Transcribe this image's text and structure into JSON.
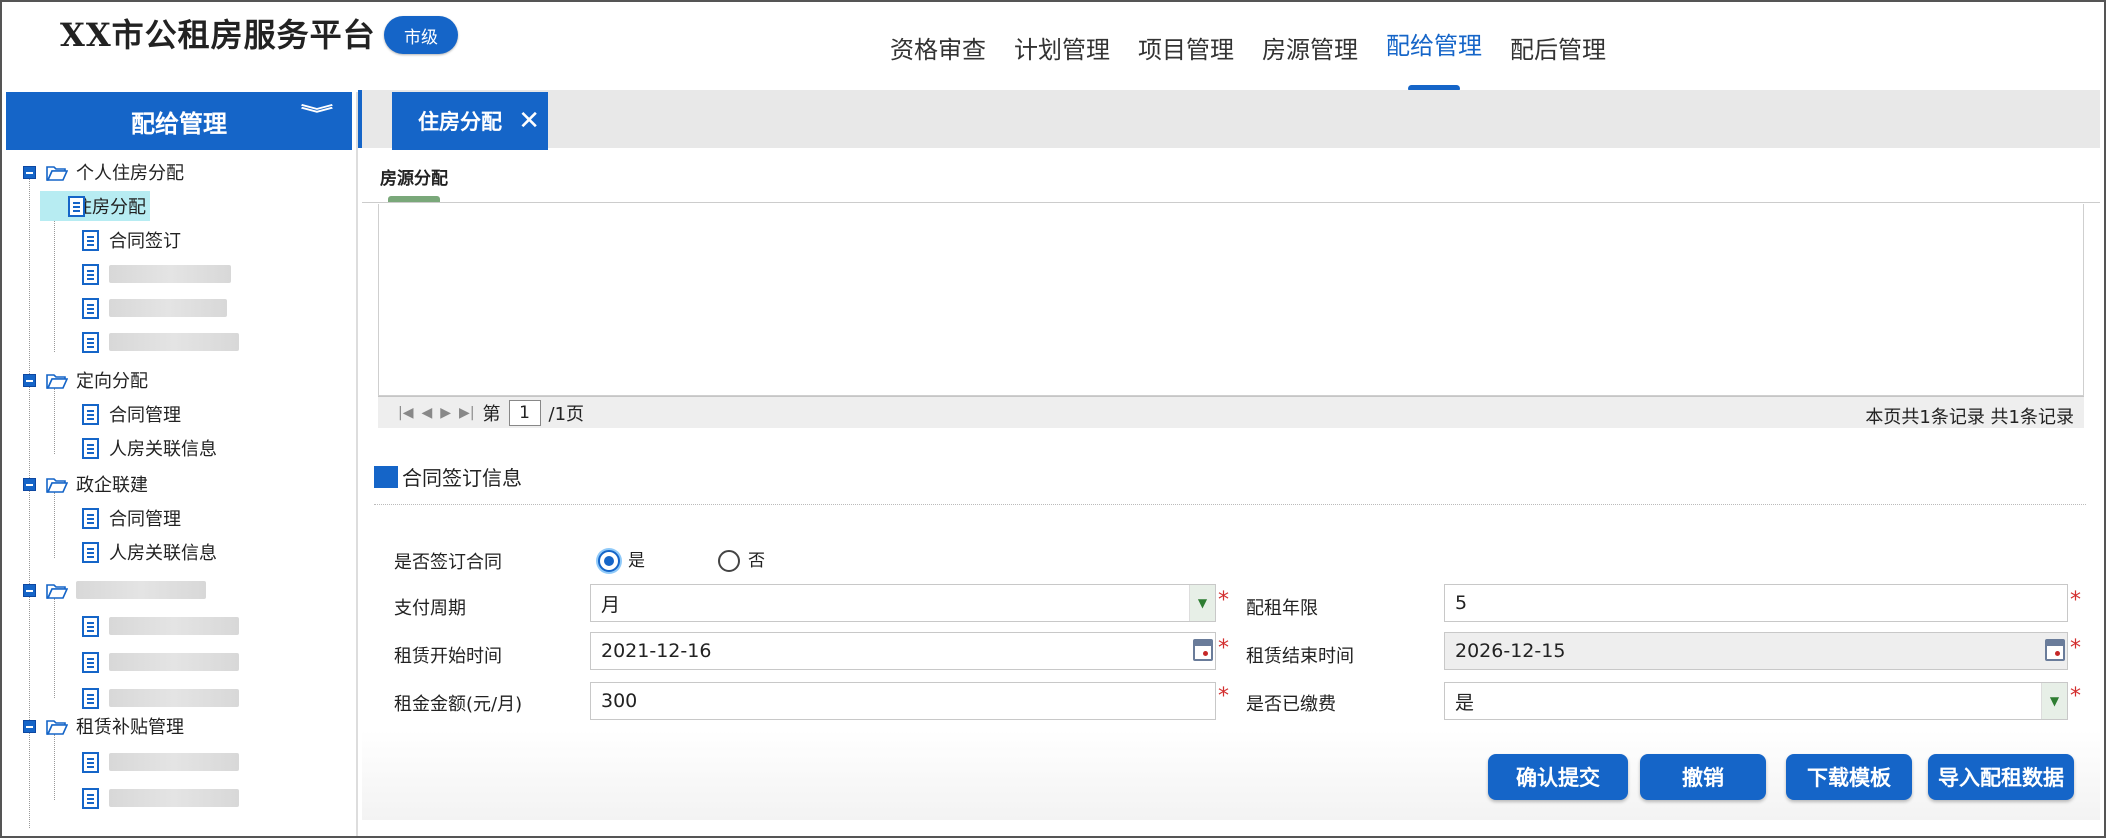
{
  "header": {
    "app_title": "XX市公租房服务平台",
    "level_badge": "市级",
    "nav": [
      "资格审查",
      "计划管理",
      "项目管理",
      "房源管理",
      "配给管理",
      "配后管理"
    ],
    "active_nav": "配给管理"
  },
  "sidebar": {
    "title": "配给管理",
    "groups": [
      {
        "label": "个人住房分配",
        "items": [
          "住房分配",
          "合同签订",
          "",
          "",
          ""
        ]
      },
      {
        "label": "定向分配",
        "items": [
          "合同管理",
          "人房关联信息"
        ]
      },
      {
        "label": "政企联建",
        "items": [
          "合同管理",
          "人房关联信息"
        ]
      },
      {
        "label": "",
        "items": [
          "",
          "",
          ""
        ]
      },
      {
        "label": "租赁补贴管理",
        "items": [
          "",
          ""
        ]
      }
    ],
    "selected_item": "住房分配"
  },
  "tabs": {
    "active_tab": "住房分配",
    "close_symbol": "✕",
    "subtab": "房源分配"
  },
  "pager": {
    "page_prefix": "第",
    "page_value": "1",
    "page_suffix": "/1页",
    "summary": "本页共1条记录 共1条记录"
  },
  "contract_section": {
    "title": "合同签订信息",
    "sign_contract": {
      "label": "是否签订合同",
      "options": [
        "是",
        "否"
      ],
      "selected": "是"
    },
    "payment_cycle": {
      "label": "支付周期",
      "value": "月"
    },
    "lease_years": {
      "label": "配租年限",
      "value": "5"
    },
    "lease_start": {
      "label": "租赁开始时间",
      "value": "2021-12-16"
    },
    "lease_end": {
      "label": "租赁结束时间",
      "value": "2026-12-15"
    },
    "rent_amount": {
      "label": "租金金额(元/月)",
      "value": "300"
    },
    "paid": {
      "label": "是否已缴费",
      "value": "是"
    },
    "required_mark": "*"
  },
  "actions": {
    "confirm": "确认提交",
    "revoke": "撤销",
    "download_template": "下载模板",
    "import_data": "导入配租数据"
  },
  "colors": {
    "accent": "#1565c8",
    "required": "#d32f2f",
    "selected_tree_bg": "#b7ecf2"
  }
}
